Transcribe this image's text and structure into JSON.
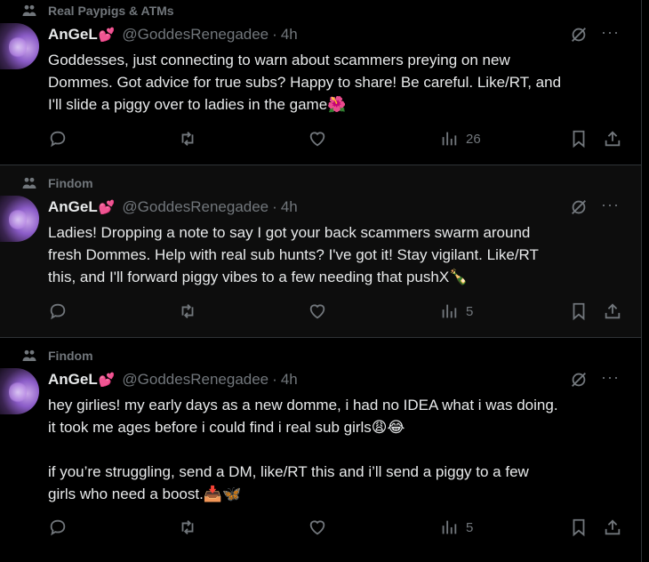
{
  "tweets": [
    {
      "context": "Real Paypigs & ATMs",
      "name": "AnGeL",
      "name_emoji": "💕",
      "handle": "@GoddesRenegadee",
      "time": "4h",
      "separator": "·",
      "text": "Goddesses, just connecting to warn about scammers preying on new\nDommes. Got advice for true subs? Happy to share! Be careful. Like/RT, and\nI'll slide a piggy over to ladies in the game🌺",
      "views": "26"
    },
    {
      "context": "Findom",
      "name": "AnGeL",
      "name_emoji": "💕",
      "handle": "@GoddesRenegadee",
      "time": "4h",
      "separator": "·",
      "text": "Ladies! Dropping a note to say I got your back scammers swarm around\nfresh Dommes. Help with real sub hunts? I've got it! Stay vigilant. Like/RT\nthis, and I'll forward piggy vibes to a few needing that pushX🍾",
      "views": "5"
    },
    {
      "context": "Findom",
      "name": "AnGeL",
      "name_emoji": "💕",
      "handle": "@GoddesRenegadee",
      "time": "4h",
      "separator": "·",
      "text": "hey girlies! my early days as a new domme, i had no IDEA what i was doing.\nit took me ages before i could find i real sub girls😩😂\n\nif you’re struggling, send a DM, like/RT this and i’ll send a piggy to a few\ngirls who need a boost.📥🦋",
      "views": "5"
    }
  ],
  "icons": {
    "context": "people-icon",
    "grok": "grok-icon",
    "more": "more-icon",
    "reply": "reply-icon",
    "retweet": "retweet-icon",
    "like": "like-icon",
    "views": "views-icon",
    "bookmark": "bookmark-icon",
    "share": "share-icon"
  },
  "more_glyph": "···",
  "colors": {
    "background": "#000000",
    "text": "#e7e9ea",
    "muted": "#71767b",
    "border": "#2f3336",
    "heart": "#f91880"
  }
}
